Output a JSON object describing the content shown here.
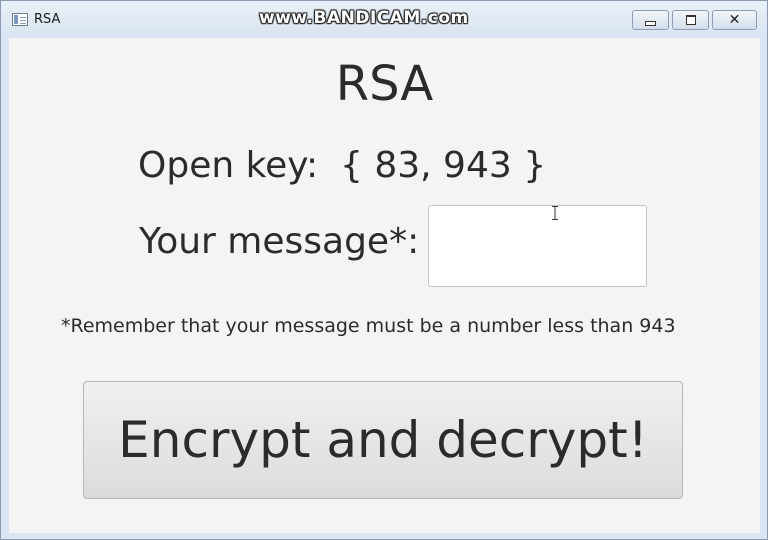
{
  "window": {
    "title": "RSA",
    "watermark": "www.BANDICAM.com",
    "controls": {
      "minimize_icon": "minimize-icon",
      "maximize_icon": "maximize-icon",
      "close_icon": "close-icon",
      "close_glyph": "✕"
    }
  },
  "main": {
    "heading": "RSA",
    "open_key_label": "Open key:",
    "open_key_value": "{ 83, 943 }",
    "message_label": "Your message*:",
    "message_value": "",
    "hint": "*Remember that your message must be a number less than 943",
    "action_button_label": "Encrypt and decrypt!"
  },
  "colors": {
    "text": "#2b2b2b",
    "background": "#f4f4f4",
    "titlebar": "#dbe6f3"
  }
}
